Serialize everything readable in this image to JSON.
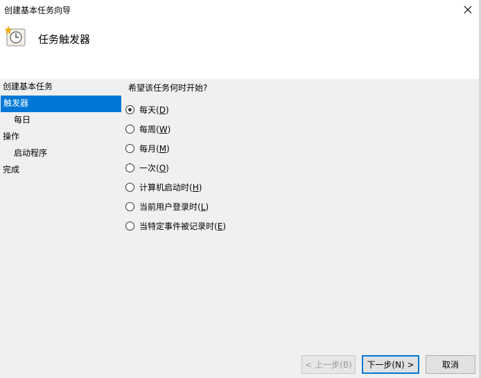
{
  "window": {
    "title": "创建基本任务向导"
  },
  "header": {
    "title": "任务触发器",
    "icon": "clock-icon"
  },
  "nav": {
    "items": [
      {
        "label": "创建基本任务",
        "sub": false,
        "active": false
      },
      {
        "label": "触发器",
        "sub": false,
        "active": true
      },
      {
        "label": "每日",
        "sub": true,
        "active": false
      },
      {
        "label": "操作",
        "sub": false,
        "active": false
      },
      {
        "label": "启动程序",
        "sub": true,
        "active": false
      },
      {
        "label": "完成",
        "sub": false,
        "active": false
      }
    ]
  },
  "main": {
    "question": "希望该任务何时开始?",
    "options": [
      {
        "label": "每天(",
        "key": "D",
        "end": ")",
        "checked": true
      },
      {
        "label": "每周(",
        "key": "W",
        "end": ")",
        "checked": false
      },
      {
        "label": "每月(",
        "key": "M",
        "end": ")",
        "checked": false
      },
      {
        "label": "一次(",
        "key": "O",
        "end": ")",
        "checked": false
      },
      {
        "label": "计算机启动时(",
        "key": "H",
        "end": ")",
        "checked": false
      },
      {
        "label": "当前用户登录时(",
        "key": "L",
        "end": ")",
        "checked": false
      },
      {
        "label": "当特定事件被记录时(",
        "key": "E",
        "end": ")",
        "checked": false
      }
    ]
  },
  "footer": {
    "back": "< 上一步(B)",
    "next": "下一步(N) >",
    "cancel": "取消"
  },
  "colors": {
    "accent": "#0078d7"
  }
}
